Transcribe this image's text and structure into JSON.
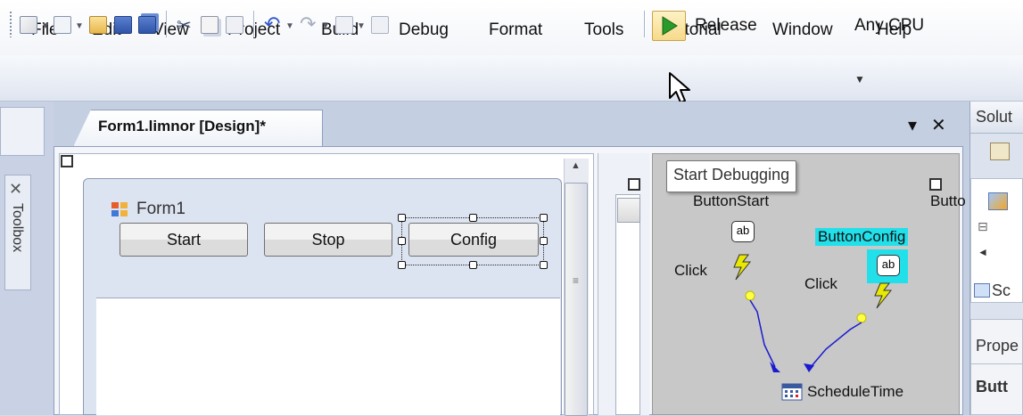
{
  "menu": [
    "File",
    "Edit",
    "View",
    "Project",
    "Build",
    "Debug",
    "Format",
    "Tools",
    "Tutorial",
    "Window",
    "Help"
  ],
  "toolbar": {
    "config_value": "Release",
    "platform_value": "Any CPU",
    "icons": [
      "new-project-icon",
      "add-item-icon",
      "open-icon",
      "save-icon",
      "save-all-icon",
      "cut-icon",
      "copy-icon",
      "paste-icon",
      "undo-icon",
      "redo-icon",
      "navigate-back-icon",
      "navigate-forward-icon",
      "start-debugging-icon"
    ]
  },
  "toolbox": {
    "label": "Toolbox"
  },
  "document": {
    "tab_title": "Form1.limnor [Design]*",
    "dropdown_glyph": "▾",
    "close_glyph": "✕"
  },
  "form": {
    "title": "Form1",
    "buttons": {
      "start": "Start",
      "stop": "Stop",
      "config": "Config"
    }
  },
  "tooltip": {
    "text": "Start Debugging"
  },
  "event_map": {
    "button_start": "ButtonStart",
    "button_truncated": "Butto",
    "button_config": "ButtonConfig",
    "click_1": "Click",
    "click_2": "Click",
    "ab_1": "ab",
    "ab_2": "ab",
    "schedule": "ScheduleTime"
  },
  "right_panel": {
    "solution_header": "Solut",
    "solution_item": "Sc",
    "properties_header": "Prope",
    "properties_item": "Butt"
  },
  "colors": {
    "highlight": "#21e0ea",
    "arrow": "#1a1ad0",
    "lightning": "#e8e800"
  }
}
